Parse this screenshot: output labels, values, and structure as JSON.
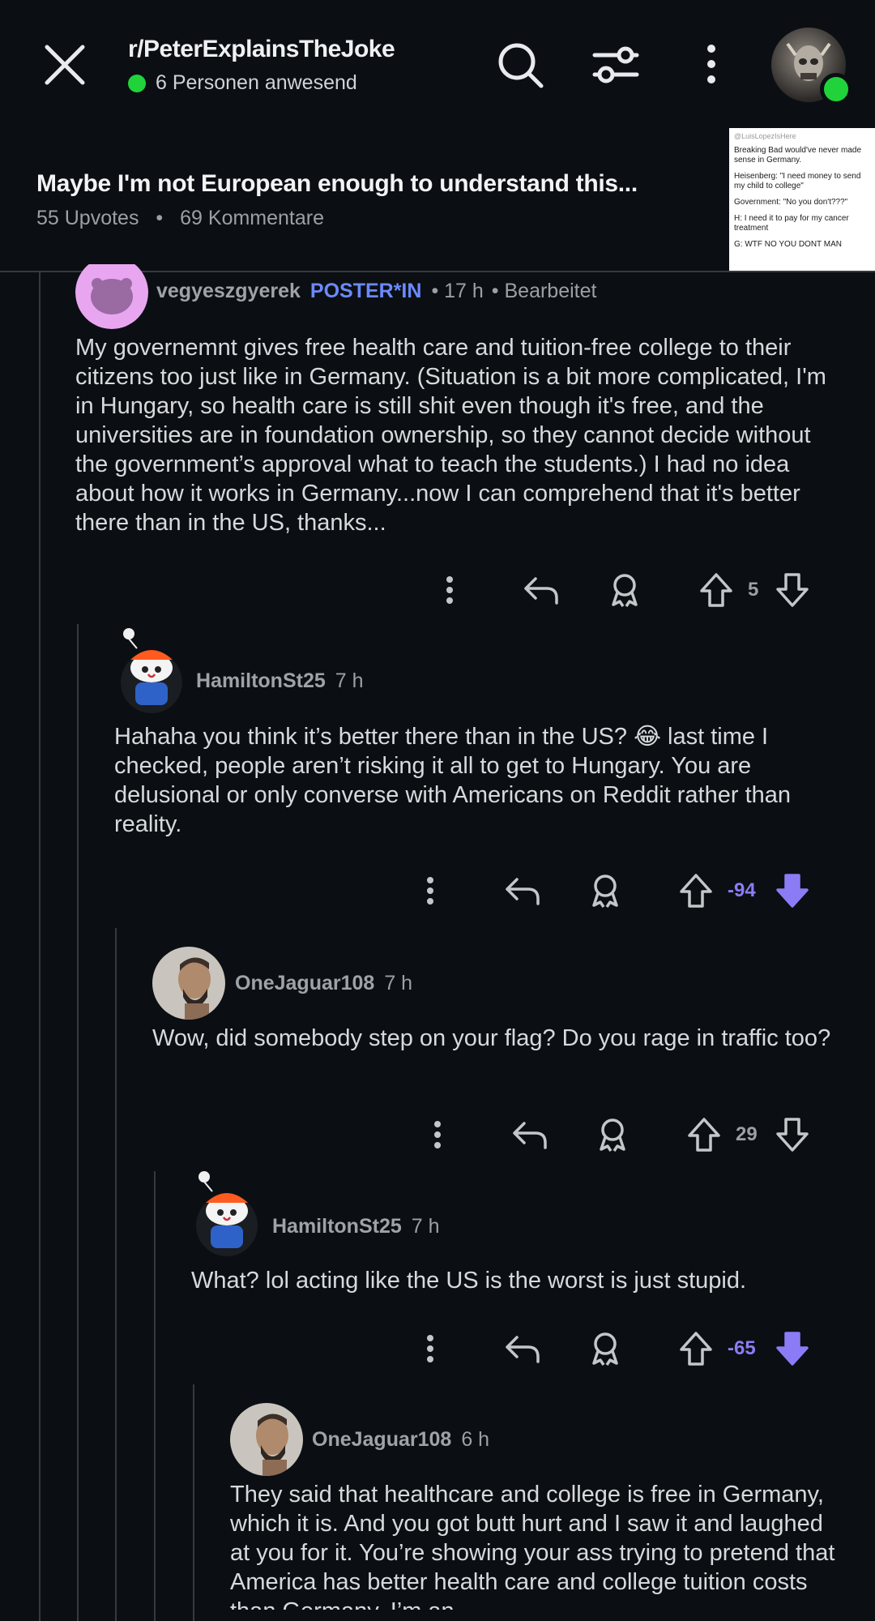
{
  "header": {
    "subreddit": "r/PeterExplainsTheJoke",
    "presence": "6 Personen anwesend"
  },
  "post": {
    "title": "Maybe I'm not European enough to understand this...",
    "upvotes": "55 Upvotes",
    "separator": "•",
    "comments": "69 Kommentare",
    "thumbnail_lines": [
      "@LuisLopezIsHere",
      "Breaking Bad would've never made sense in Germany.",
      "Heisenberg: \"I need money to send my child to college\"",
      "Government: \"No you don't???\"",
      "H: I need it to pay for my cancer treatment",
      "G: WTF NO YOU DONT MAN"
    ]
  },
  "comments": [
    {
      "user": "vegyeszgyerek",
      "badge": "POSTER*IN",
      "time": "• 17 h",
      "edited": "• Bearbeitet",
      "text": "My governemnt gives free health care and tuition-free college to their citizens too just like in Germany. (Situation is a bit more complicated, I'm in Hungary, so health care is still shit even though it's free, and the universities are in foundation ownership, so they cannot decide without the government’s approval what to teach the students.) I had no idea about how it works in Germany...now I can comprehend that it's better there than in the US, thanks...",
      "votes": "5"
    },
    {
      "user": "HamiltonSt25",
      "time": "7 h",
      "text": "Hahaha you think it’s better there than in the US? 😂 last time I checked, people aren’t risking it all to get to Hungary. You are delusional or only converse with Americans on Reddit rather than reality.",
      "votes": "-94"
    },
    {
      "user": "OneJaguar108",
      "time": "7 h",
      "text": "Wow, did somebody step on your flag? Do you rage in traffic too?",
      "votes": "29"
    },
    {
      "user": "HamiltonSt25",
      "time": "7 h",
      "text": "What? lol acting like the US is the worst is just stupid.",
      "votes": "-65"
    },
    {
      "user": "OneJaguar108",
      "time": "6 h",
      "text": "They said that healthcare and college is free in Germany, which it is. And you got butt hurt and I saw it and laughed at you for it. You’re showing your ass trying to pretend that America has better health care and college tuition costs than Germany. I’m an"
    }
  ],
  "colors": {
    "background": "#0b0f13",
    "online": "#20d33b",
    "poster_badge": "#6b8afd",
    "downvoted": "#8b7cf6"
  }
}
